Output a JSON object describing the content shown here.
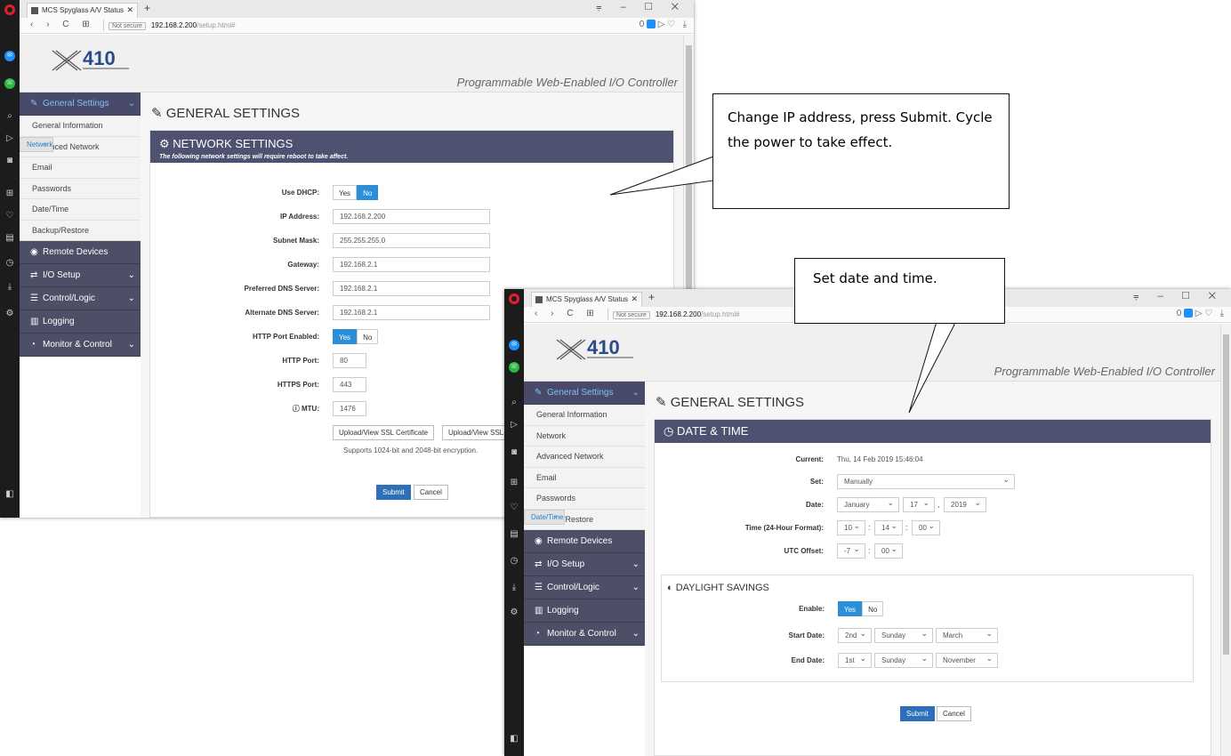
{
  "browser": {
    "tab_title": "MCS Spyglass A/V Status",
    "new_tab": "+",
    "nav_glyphs": "‹ › C ⊞",
    "not_secure": "Not secure",
    "url_host": "192.168.2.200",
    "url_path": "/setup.html#",
    "window_controls": "⩦ – ☐ ✕",
    "tab_close": "✕"
  },
  "header": {
    "logo_text": "X410",
    "tagline": "Programmable Web-Enabled I/O Controller"
  },
  "sidebar": {
    "general_settings": "General Settings",
    "sub_items": [
      "General Information",
      "Network",
      "Advanced Network",
      "Email",
      "Passwords",
      "Date/Time",
      "Backup/Restore"
    ],
    "remote_devices": "Remote Devices",
    "io_setup": "I/O Setup",
    "control_logic": "Control/Logic",
    "logging": "Logging",
    "monitor_control": "Monitor & Control"
  },
  "page_title": "GENERAL SETTINGS",
  "network": {
    "title": "NETWORK SETTINGS",
    "subtitle": "The following network settings will require reboot to take affect.",
    "use_dhcp_label": "Use DHCP:",
    "yes": "Yes",
    "no": "No",
    "ip_label": "IP Address:",
    "ip_value": "192.168.2.200",
    "subnet_label": "Subnet Mask:",
    "subnet_value": "255.255.255.0",
    "gateway_label": "Gateway:",
    "gateway_value": "192.168.2.1",
    "pref_dns_label": "Preferred DNS Server:",
    "pref_dns_value": "192.168.2.1",
    "alt_dns_label": "Alternate DNS Server:",
    "alt_dns_value": "192.168.2.1",
    "http_enabled_label": "HTTP Port Enabled:",
    "http_port_label": "HTTP Port:",
    "http_port_value": "80",
    "https_port_label": "HTTPS Port:",
    "https_port_value": "443",
    "mtu_label": "MTU:",
    "mtu_value": "1476",
    "ssl_cert_button": "Upload/View SSL Certificate",
    "ssl_key_button": "Upload/View SSL Key",
    "ssl_note": "Supports 1024-bit and 2048-bit encryption.",
    "submit": "Submit",
    "cancel": "Cancel"
  },
  "datetime": {
    "title": "DATE & TIME",
    "current_label": "Current:",
    "current_value": "Thu, 14 Feb 2019 15:46:04",
    "set_label": "Set:",
    "set_value": "Manually",
    "date_label": "Date:",
    "month": "January",
    "day": "17",
    "year": "2019",
    "time_label": "Time (24-Hour Format):",
    "hour": "10",
    "minute": "14",
    "second": "00",
    "utc_label": "UTC Offset:",
    "utc_hours": "-7",
    "utc_minutes": "00",
    "dst_title": "DAYLIGHT SAVINGS",
    "enable_label": "Enable:",
    "yes": "Yes",
    "no": "No",
    "start_label": "Start Date:",
    "start_week": "2nd",
    "start_day": "Sunday",
    "start_month": "March",
    "end_label": "End Date:",
    "end_week": "1st",
    "end_day": "Sunday",
    "end_month": "November",
    "submit": "Submit",
    "cancel": "Cancel"
  },
  "callouts": {
    "ip_note": "Change IP address, press Submit.  Cycle the power to take effect.",
    "date_note": "Set date and time."
  },
  "colors": {
    "panel_header": "#4e5170",
    "sidebar": "#4d4f66",
    "accent": "#2b8ed8"
  }
}
